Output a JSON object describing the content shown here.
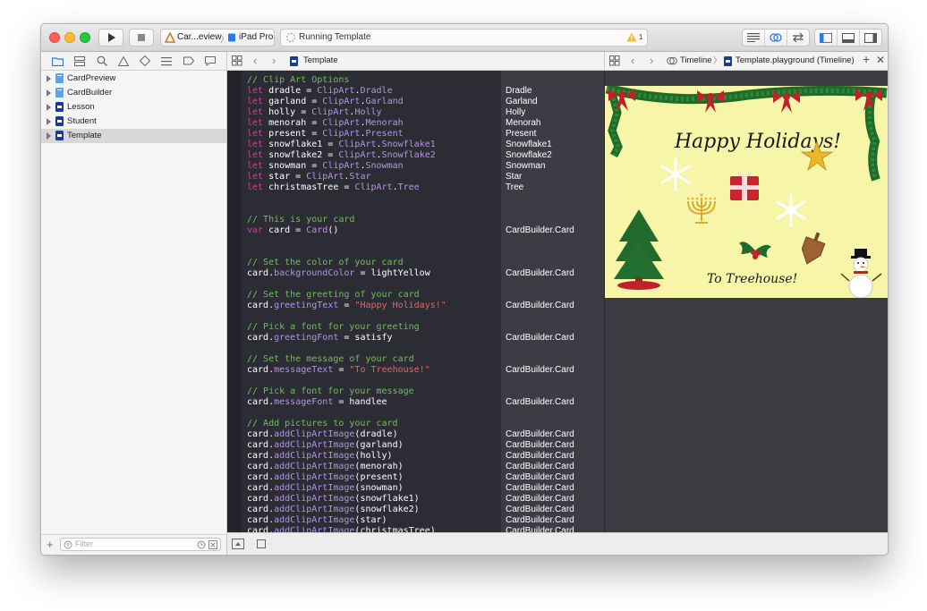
{
  "toolbar": {
    "scheme_target": "Car...eview",
    "scheme_device": "iPad Pro",
    "activity_status": "Running Template",
    "warning_count": "1"
  },
  "navigator": {
    "items": [
      {
        "label": "CardPreview",
        "type": "folder"
      },
      {
        "label": "CardBuilder",
        "type": "folder"
      },
      {
        "label": "Lesson",
        "type": "page"
      },
      {
        "label": "Student",
        "type": "page"
      },
      {
        "label": "Template",
        "type": "page",
        "selected": true
      }
    ],
    "filter_placeholder": "Filter"
  },
  "editor": {
    "file_name": "Template",
    "lines": [
      {
        "parts": [
          {
            "c": "cm",
            "t": "// Clip Art Options"
          }
        ]
      },
      {
        "parts": [
          {
            "c": "kw",
            "t": "let"
          },
          {
            "c": "",
            "t": " dradle = "
          },
          {
            "c": "ty",
            "t": "ClipArt"
          },
          {
            "c": "",
            "t": "."
          },
          {
            "c": "ty",
            "t": "Dradle"
          }
        ]
      },
      {
        "parts": [
          {
            "c": "kw",
            "t": "let"
          },
          {
            "c": "",
            "t": " garland = "
          },
          {
            "c": "ty",
            "t": "ClipArt"
          },
          {
            "c": "",
            "t": "."
          },
          {
            "c": "ty",
            "t": "Garland"
          }
        ]
      },
      {
        "parts": [
          {
            "c": "kw",
            "t": "let"
          },
          {
            "c": "",
            "t": " holly = "
          },
          {
            "c": "ty",
            "t": "ClipArt"
          },
          {
            "c": "",
            "t": "."
          },
          {
            "c": "ty",
            "t": "Holly"
          }
        ]
      },
      {
        "parts": [
          {
            "c": "kw",
            "t": "let"
          },
          {
            "c": "",
            "t": " menorah = "
          },
          {
            "c": "ty",
            "t": "ClipArt"
          },
          {
            "c": "",
            "t": "."
          },
          {
            "c": "ty",
            "t": "Menorah"
          }
        ]
      },
      {
        "parts": [
          {
            "c": "kw",
            "t": "let"
          },
          {
            "c": "",
            "t": " present = "
          },
          {
            "c": "ty",
            "t": "ClipArt"
          },
          {
            "c": "",
            "t": "."
          },
          {
            "c": "ty",
            "t": "Present"
          }
        ]
      },
      {
        "parts": [
          {
            "c": "kw",
            "t": "let"
          },
          {
            "c": "",
            "t": " snowflake1 = "
          },
          {
            "c": "ty",
            "t": "ClipArt"
          },
          {
            "c": "",
            "t": "."
          },
          {
            "c": "ty",
            "t": "Snowflake1"
          }
        ]
      },
      {
        "parts": [
          {
            "c": "kw",
            "t": "let"
          },
          {
            "c": "",
            "t": " snowflake2 = "
          },
          {
            "c": "ty",
            "t": "ClipArt"
          },
          {
            "c": "",
            "t": "."
          },
          {
            "c": "ty",
            "t": "Snowflake2"
          }
        ]
      },
      {
        "parts": [
          {
            "c": "kw",
            "t": "let"
          },
          {
            "c": "",
            "t": " snowman = "
          },
          {
            "c": "ty",
            "t": "ClipArt"
          },
          {
            "c": "",
            "t": "."
          },
          {
            "c": "ty",
            "t": "Snowman"
          }
        ]
      },
      {
        "parts": [
          {
            "c": "kw",
            "t": "let"
          },
          {
            "c": "",
            "t": " star = "
          },
          {
            "c": "ty",
            "t": "ClipArt"
          },
          {
            "c": "",
            "t": "."
          },
          {
            "c": "ty",
            "t": "Star"
          }
        ]
      },
      {
        "parts": [
          {
            "c": "kw",
            "t": "let"
          },
          {
            "c": "",
            "t": " christmasTree = "
          },
          {
            "c": "ty",
            "t": "ClipArt"
          },
          {
            "c": "",
            "t": "."
          },
          {
            "c": "ty",
            "t": "Tree"
          }
        ]
      },
      {
        "parts": []
      },
      {
        "parts": []
      },
      {
        "parts": [
          {
            "c": "cm",
            "t": "// This is your card"
          }
        ]
      },
      {
        "parts": [
          {
            "c": "kw",
            "t": "var"
          },
          {
            "c": "",
            "t": " card = "
          },
          {
            "c": "ty",
            "t": "Card"
          },
          {
            "c": "",
            "t": "()"
          }
        ]
      },
      {
        "parts": []
      },
      {
        "parts": []
      },
      {
        "parts": [
          {
            "c": "cm",
            "t": "// Set the color of your card"
          }
        ]
      },
      {
        "parts": [
          {
            "c": "",
            "t": "card."
          },
          {
            "c": "ty",
            "t": "backgroundColor"
          },
          {
            "c": "",
            "t": " = lightYellow"
          }
        ]
      },
      {
        "parts": []
      },
      {
        "parts": [
          {
            "c": "cm",
            "t": "// Set the greeting of your card"
          }
        ]
      },
      {
        "parts": [
          {
            "c": "",
            "t": "card."
          },
          {
            "c": "ty",
            "t": "greetingText"
          },
          {
            "c": "",
            "t": " = "
          },
          {
            "c": "st",
            "t": "\"Happy Holidays!\""
          }
        ]
      },
      {
        "parts": []
      },
      {
        "parts": [
          {
            "c": "cm",
            "t": "// Pick a font for your greeting"
          }
        ]
      },
      {
        "parts": [
          {
            "c": "",
            "t": "card."
          },
          {
            "c": "ty",
            "t": "greetingFont"
          },
          {
            "c": "",
            "t": " = satisfy"
          }
        ]
      },
      {
        "parts": []
      },
      {
        "parts": [
          {
            "c": "cm",
            "t": "// Set the message of your card"
          }
        ]
      },
      {
        "parts": [
          {
            "c": "",
            "t": "card."
          },
          {
            "c": "ty",
            "t": "messageText"
          },
          {
            "c": "",
            "t": " = "
          },
          {
            "c": "st",
            "t": "\"To Treehouse!\""
          }
        ]
      },
      {
        "parts": []
      },
      {
        "parts": [
          {
            "c": "cm",
            "t": "// Pick a font for your message"
          }
        ]
      },
      {
        "parts": [
          {
            "c": "",
            "t": "card."
          },
          {
            "c": "ty",
            "t": "messageFont"
          },
          {
            "c": "",
            "t": " = handlee"
          }
        ]
      },
      {
        "parts": []
      },
      {
        "parts": [
          {
            "c": "cm",
            "t": "// Add pictures to your card"
          }
        ]
      },
      {
        "parts": [
          {
            "c": "",
            "t": "card."
          },
          {
            "c": "ty",
            "t": "addClipArtImage"
          },
          {
            "c": "",
            "t": "(dradle)"
          }
        ]
      },
      {
        "parts": [
          {
            "c": "",
            "t": "card."
          },
          {
            "c": "ty",
            "t": "addClipArtImage"
          },
          {
            "c": "",
            "t": "(garland)"
          }
        ]
      },
      {
        "parts": [
          {
            "c": "",
            "t": "card."
          },
          {
            "c": "ty",
            "t": "addClipArtImage"
          },
          {
            "c": "",
            "t": "(holly)"
          }
        ]
      },
      {
        "parts": [
          {
            "c": "",
            "t": "card."
          },
          {
            "c": "ty",
            "t": "addClipArtImage"
          },
          {
            "c": "",
            "t": "(menorah)"
          }
        ]
      },
      {
        "parts": [
          {
            "c": "",
            "t": "card."
          },
          {
            "c": "ty",
            "t": "addClipArtImage"
          },
          {
            "c": "",
            "t": "(present)"
          }
        ]
      },
      {
        "parts": [
          {
            "c": "",
            "t": "card."
          },
          {
            "c": "ty",
            "t": "addClipArtImage"
          },
          {
            "c": "",
            "t": "(snowman)"
          }
        ]
      },
      {
        "parts": [
          {
            "c": "",
            "t": "card."
          },
          {
            "c": "ty",
            "t": "addClipArtImage"
          },
          {
            "c": "",
            "t": "(snowflake1)"
          }
        ]
      },
      {
        "parts": [
          {
            "c": "",
            "t": "card."
          },
          {
            "c": "ty",
            "t": "addClipArtImage"
          },
          {
            "c": "",
            "t": "(snowflake2)"
          }
        ]
      },
      {
        "parts": [
          {
            "c": "",
            "t": "card."
          },
          {
            "c": "ty",
            "t": "addClipArtImage"
          },
          {
            "c": "",
            "t": "(star)"
          }
        ]
      },
      {
        "parts": [
          {
            "c": "",
            "t": "card."
          },
          {
            "c": "ty",
            "t": "addClipArtImage"
          },
          {
            "c": "",
            "t": "(christmasTree)"
          }
        ]
      }
    ],
    "results": [
      "Dradle",
      "Garland",
      "Holly",
      "Menorah",
      "Present",
      "Snowflake1",
      "Snowflake2",
      "Snowman",
      "Star",
      "Tree",
      "",
      "",
      "",
      "CardBuilder.Card",
      "",
      "",
      "",
      "CardBuilder.Card",
      "",
      "",
      "CardBuilder.Card",
      "",
      "",
      "CardBuilder.Card",
      "",
      "",
      "CardBuilder.Card",
      "",
      "",
      "CardBuilder.Card",
      "",
      "",
      "CardBuilder.Card",
      "CardBuilder.Card",
      "CardBuilder.Card",
      "CardBuilder.Card",
      "CardBuilder.Card",
      "CardBuilder.Card",
      "CardBuilder.Card",
      "CardBuilder.Card",
      "CardBuilder.Card",
      "CardBuilder.Card"
    ]
  },
  "assistant": {
    "mode": "Timeline",
    "file": "Template.playground (Timeline)"
  },
  "card": {
    "greeting": "Happy Holidays!",
    "message": "To Treehouse!",
    "background": "#f7f5a8"
  },
  "colors": {
    "comment": "#6bc34e",
    "keyword": "#d53c9b",
    "type": "#b98ff0",
    "string": "#ff5a5a",
    "editor_bg": "#2b2c34",
    "selection": "#d8d8d8"
  }
}
